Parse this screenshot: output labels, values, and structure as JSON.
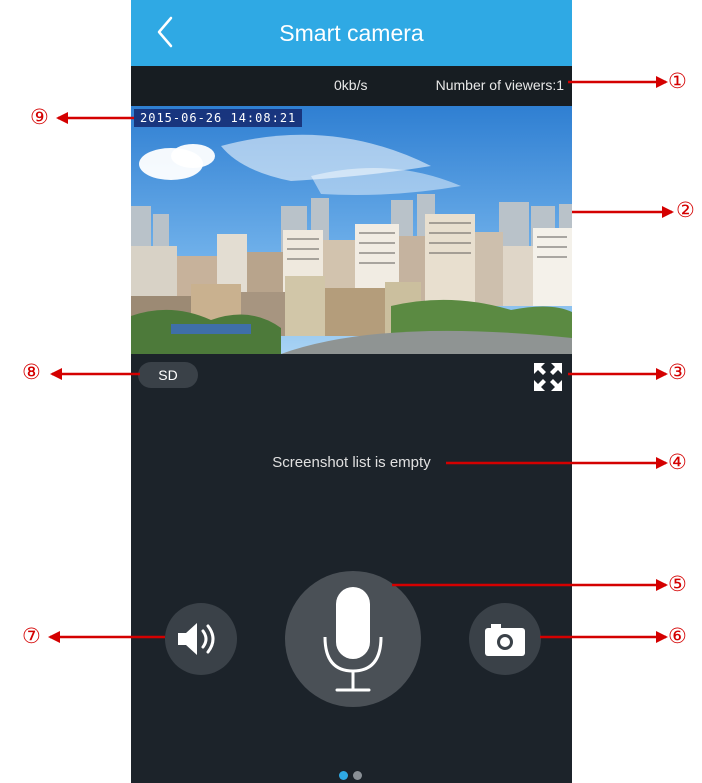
{
  "app": {
    "title": "Smart camera",
    "back_icon": "chevron-left-icon"
  },
  "info_bar": {
    "speed": "0kb/s",
    "viewers": "Number of viewers:1"
  },
  "video": {
    "timestamp": "2015-06-26   14:08:21"
  },
  "controls": {
    "quality_label": "SD",
    "fullscreen_icon": "fullscreen-icon",
    "speaker_icon": "speaker-icon",
    "mic_icon": "microphone-icon",
    "camera_icon": "camera-icon"
  },
  "screenshots": {
    "empty_message": "Screenshot list is empty"
  },
  "pager": {
    "pages": 2,
    "active": 1
  },
  "callouts": [
    "①",
    "②",
    "③",
    "④",
    "⑤",
    "⑥",
    "⑦",
    "⑧",
    "⑨"
  ],
  "colors": {
    "titlebar": "#2fa9e4",
    "background": "#1c232a",
    "callout": "#d40000",
    "pager_active": "#2fa9e4",
    "pager_inactive": "#8a9096"
  }
}
